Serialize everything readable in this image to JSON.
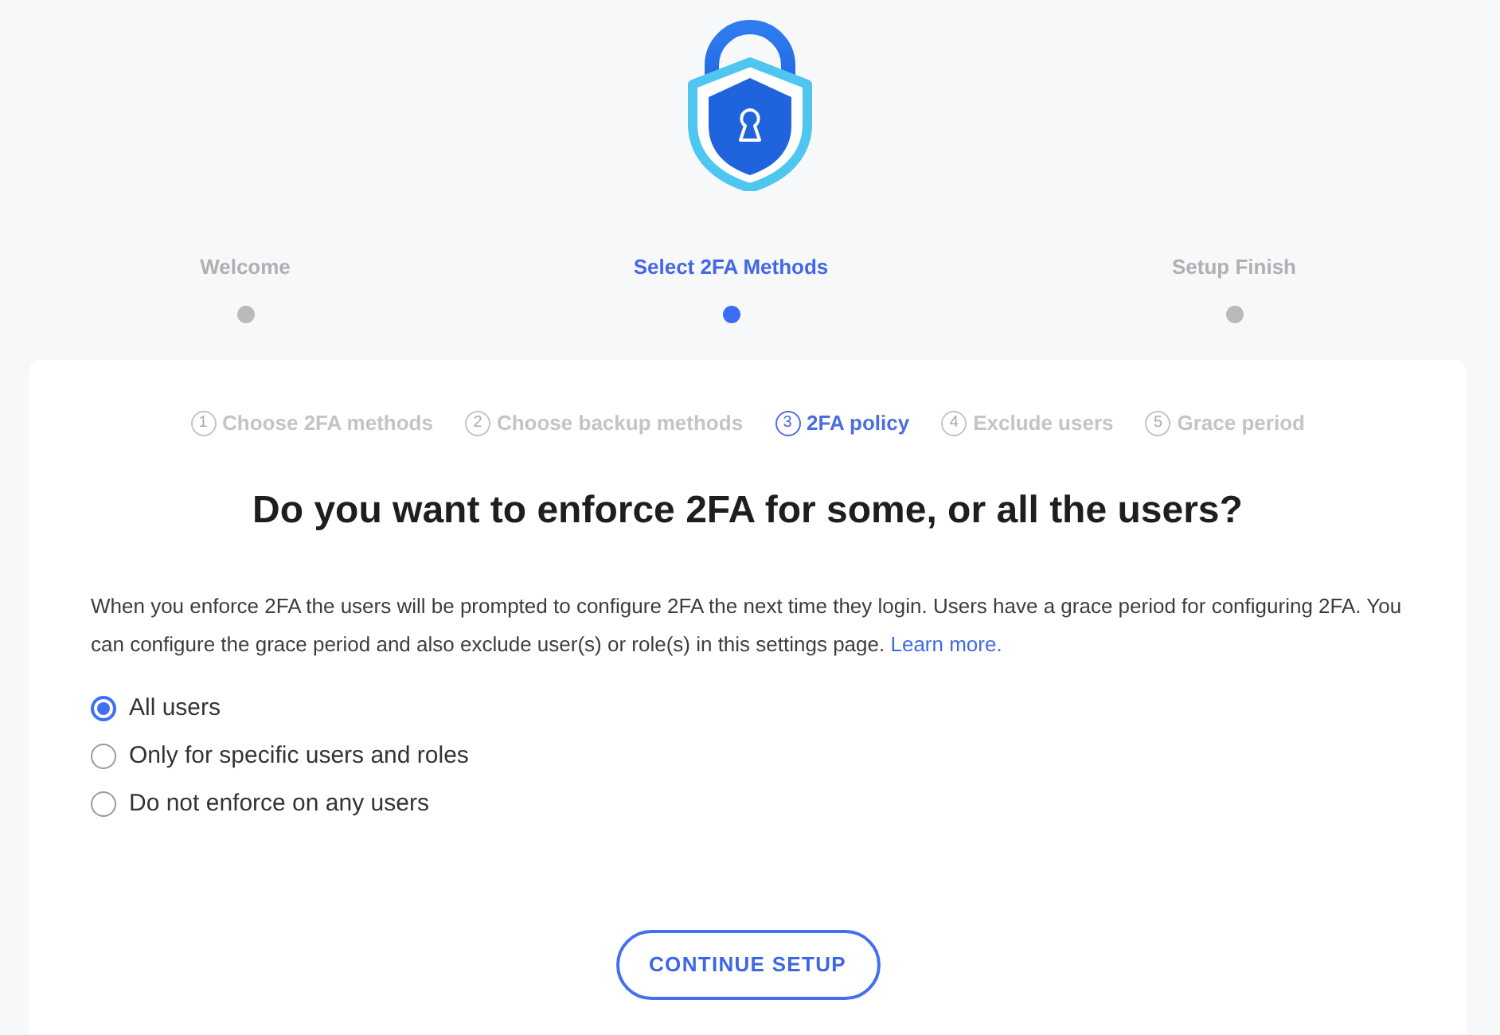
{
  "wizard_steps": [
    {
      "label": "Welcome",
      "selected": false
    },
    {
      "label": "Select 2FA Methods",
      "selected": true
    },
    {
      "label": "Setup Finish",
      "selected": false
    }
  ],
  "card": {
    "substeps": [
      {
        "number": "1",
        "label": "Choose 2FA methods",
        "selected": false
      },
      {
        "number": "2",
        "label": "Choose backup methods",
        "selected": false
      },
      {
        "number": "3",
        "label": "2FA policy",
        "selected": true
      },
      {
        "number": "4",
        "label": "Exclude users",
        "selected": false
      },
      {
        "number": "5",
        "label": "Grace period",
        "selected": false
      }
    ],
    "heading": "Do you want to enforce 2FA for some, or all the users?",
    "description": "When you enforce 2FA the users will be prompted to configure 2FA the next time they login. Users have a grace period for configuring 2FA. You can configure the grace period and also exclude user(s) or role(s) in this settings page.",
    "learn_more_link": "Learn more.",
    "options": [
      {
        "label": "All users",
        "selected": true
      },
      {
        "label": "Only for specific users and roles",
        "selected": false
      },
      {
        "label": "Do not enforce on any users",
        "selected": false
      }
    ],
    "continue_button": "CONTINUE SETUP"
  }
}
